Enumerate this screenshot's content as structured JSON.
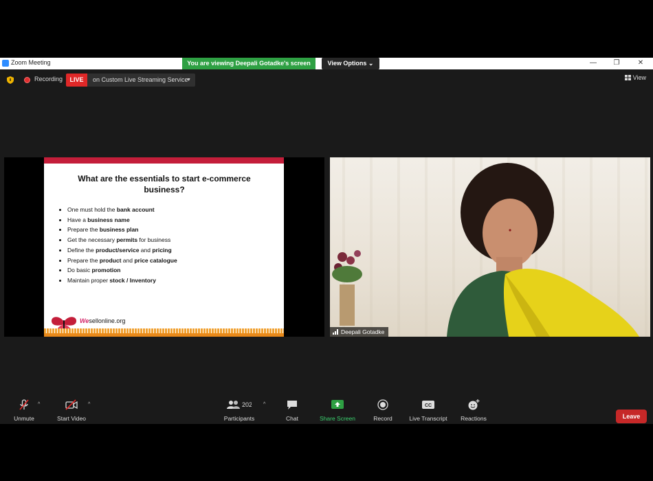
{
  "window": {
    "title": "Zoom Meeting",
    "viewing_banner": "You are viewing Deepali Gotadke's screen",
    "view_options": "View Options",
    "controls": {
      "minimize": "—",
      "restore": "❐",
      "close": "✕"
    }
  },
  "top_bar": {
    "recording_label": "Recording",
    "live_badge": "LIVE",
    "stream_service": "on Custom Live Streaming Service",
    "view_label": "View"
  },
  "slide": {
    "title": "What are the essentials to start e-commerce business?",
    "bullets": [
      {
        "pre": "One must hold the ",
        "bold": "bank account",
        "post": ""
      },
      {
        "pre": "Have a ",
        "bold": "business name",
        "post": ""
      },
      {
        "pre": "Prepare the ",
        "bold": "business plan",
        "post": ""
      },
      {
        "pre": "Get the necessary ",
        "bold": "permits",
        "post": " for business"
      },
      {
        "pre": "Define the ",
        "bold": "product/service",
        "post": " and ",
        "bold2": "pricing"
      },
      {
        "pre": "Prepare the ",
        "bold": "product",
        "post": " and ",
        "bold2": "price catalogue"
      },
      {
        "pre": "Do basic ",
        "bold": "promotion",
        "post": ""
      },
      {
        "pre": "Maintain proper ",
        "bold": "stock / Inventory",
        "post": ""
      }
    ],
    "logo_we": "We",
    "logo_rest": "sellonline.org"
  },
  "participant": {
    "name": "Deepali Gotadke"
  },
  "toolbar": {
    "unmute": "Unmute",
    "start_video": "Start Video",
    "participants": "Participants",
    "participants_count": "202",
    "chat": "Chat",
    "share_screen": "Share Screen",
    "record": "Record",
    "live_transcript": "Live Transcript",
    "reactions": "Reactions",
    "leave": "Leave"
  },
  "colors": {
    "banner_green": "#2ea043",
    "live_red": "#e02828",
    "leave_red": "#c62828",
    "share_green": "#2ea043",
    "slide_stripe": "#c41e3a"
  },
  "icons": [
    "zoom-logo-icon",
    "shield-icon",
    "record-dot-icon",
    "view-grid-icon",
    "mic-muted-icon",
    "video-off-icon",
    "participants-icon",
    "chat-icon",
    "share-screen-icon",
    "record-icon",
    "cc-icon",
    "reactions-icon",
    "signal-icon"
  ]
}
